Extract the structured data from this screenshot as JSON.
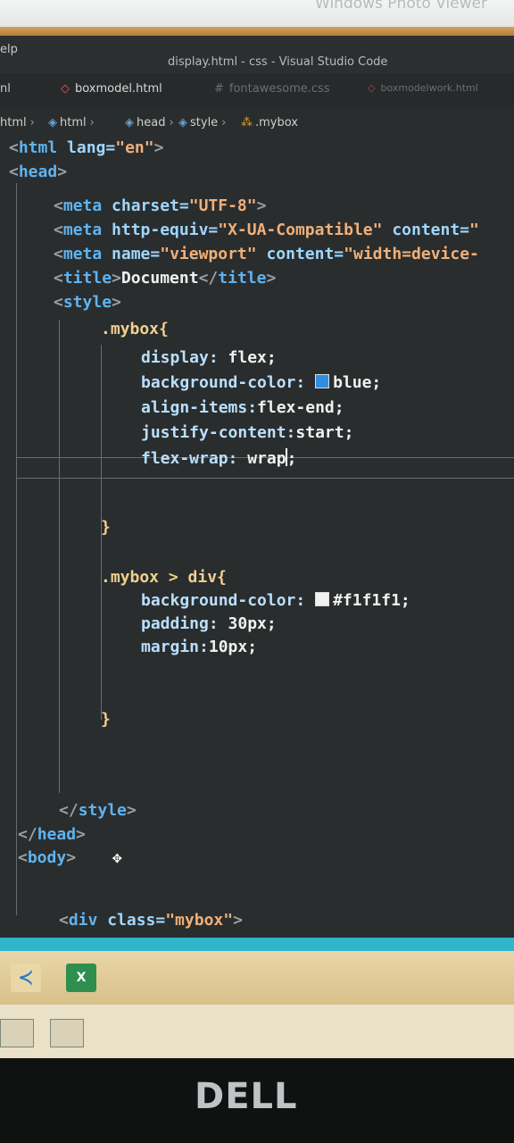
{
  "viewer": {
    "title": "Windows Photo Viewer"
  },
  "window": {
    "title": "display.html - css - Visual Studio Code",
    "menu_help": "elp"
  },
  "tabs": [
    {
      "label": "nl"
    },
    {
      "label": "boxmodel.html"
    },
    {
      "label": "fontawesome.css"
    },
    {
      "label": "boxmodelwork.html"
    }
  ],
  "breadcrumb": {
    "items": [
      "html",
      "html",
      "head",
      "style",
      ".mybox"
    ]
  },
  "code": {
    "l1": {
      "open": "<",
      "tag": "html",
      "attr": " lang=",
      "str": "\"en\"",
      "close": ">"
    },
    "l2": {
      "open": "<",
      "tag": "head",
      "close": ">"
    },
    "l3": {
      "open": "<",
      "tag": "meta",
      "attr": " charset=",
      "str": "\"UTF-8\"",
      "close": ">"
    },
    "l4": {
      "open": "<",
      "tag": "meta",
      "attr": " http-equiv=",
      "str": "\"X-UA-Compatible\"",
      "attr2": " content=",
      "str2": "\""
    },
    "l5": {
      "open": "<",
      "tag": "meta",
      "attr": " name=",
      "str": "\"viewport\"",
      "attr2": " content=",
      "str2": "\"width=device-"
    },
    "l6": {
      "open": "<",
      "tag": "title",
      "close": ">",
      "text": "Document",
      "open2": "</",
      "tag2": "title",
      "close2": ">"
    },
    "l7": {
      "open": "<",
      "tag": "style",
      "close": ">"
    },
    "l8": {
      "sel": ".mybox{"
    },
    "l9": {
      "prop": "display:",
      "val": " flex;"
    },
    "l10": {
      "prop": "background-color:",
      "val": "blue;",
      "swatch": "#2e8fe0"
    },
    "l11": {
      "prop": "align-items:",
      "val": "flex-end;"
    },
    "l12": {
      "prop": "justify-content:",
      "val": "start;"
    },
    "l13": {
      "prop": "flex-wrap:",
      "val1": " wrap",
      "val2": ";"
    },
    "l14": {
      "text": "}"
    },
    "l15": {
      "sel": ".mybox > div{"
    },
    "l16": {
      "prop": "background-color:",
      "val": "#f1f1f1;",
      "swatch": "#f1f1f1"
    },
    "l17": {
      "prop": "padding:",
      "val": " 30px;"
    },
    "l18": {
      "prop": "margin:",
      "val": "10px;"
    },
    "l19": {
      "text": "}"
    },
    "l20": {
      "open": "</",
      "tag": "style",
      "close": ">"
    },
    "l21": {
      "open": "</",
      "tag": "head",
      "close": ">"
    },
    "l22": {
      "open": "<",
      "tag": "body",
      "close": ">"
    },
    "l23": {
      "open": "<",
      "tag": "div",
      "attr": " class=",
      "str": "\"mybox\"",
      "close": ">"
    }
  },
  "taskbar": {
    "vscode_icon": "vscode-icon",
    "excel_label": "X"
  },
  "monitor": {
    "brand": "DELL"
  }
}
